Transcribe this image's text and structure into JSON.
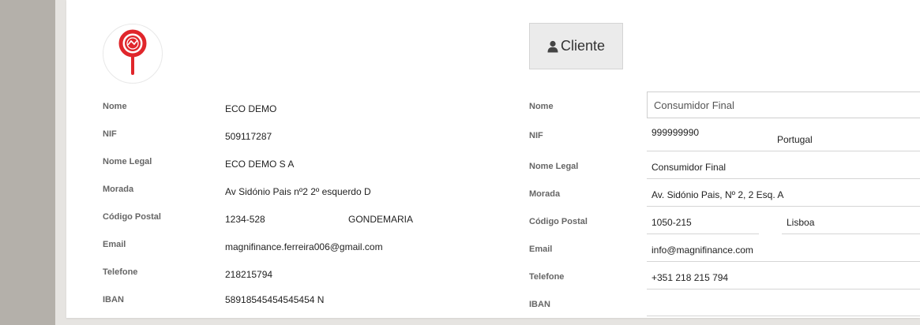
{
  "entity": {
    "labels": {
      "name": "Nome",
      "nif": "NIF",
      "legal_name": "Nome Legal",
      "address": "Morada",
      "postal_code": "Código Postal",
      "email": "Email",
      "phone": "Telefone",
      "iban": "IBAN"
    },
    "values": {
      "name": "ECO DEMO",
      "nif": "509117287",
      "legal_name": "ECO DEMO S A",
      "address": "Av Sidónio Pais nº2 2º esquerdo D",
      "postal_code": "1234-528",
      "city": "GONDEMARIA",
      "email": "magnifinance.ferreira006@gmail.com",
      "phone": "218215794",
      "iban": "58918545454545454 N"
    }
  },
  "client": {
    "button_label": "Cliente",
    "button_icon": "user-icon",
    "labels": {
      "name": "Nome",
      "nif": "NIF",
      "legal_name": "Nome Legal",
      "address": "Morada",
      "postal_code": "Código Postal",
      "email": "Email",
      "phone": "Telefone",
      "iban": "IBAN"
    },
    "values": {
      "name": "Consumidor Final",
      "nif": "999999990",
      "country": "Portugal",
      "legal_name": "Consumidor Final",
      "address": "Av. Sidónio Pais, Nº 2, 2 Esq. A",
      "postal_code": "1050-215",
      "city": "Lisboa",
      "email": "info@magnifinance.com",
      "phone": "+351 218 215 794",
      "iban": ""
    }
  },
  "colors": {
    "logo_red": "#e0262b",
    "card_bg": "#ffffff",
    "page_bg": "#b4b0a9"
  }
}
